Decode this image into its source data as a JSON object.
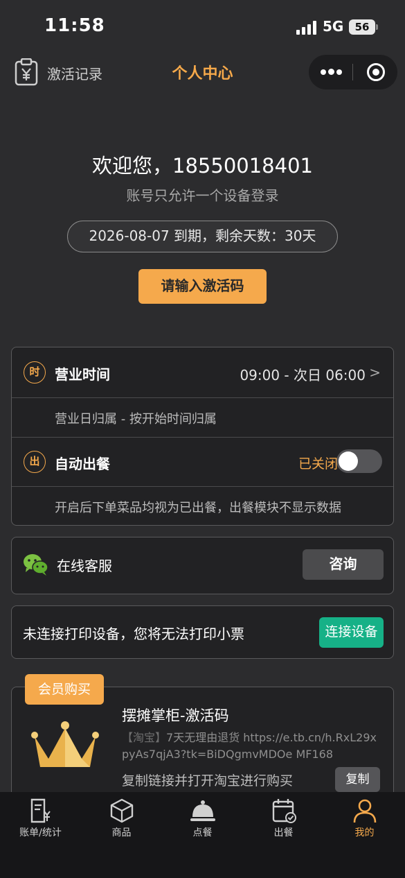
{
  "status_bar": {
    "time": "11:58",
    "network": "5G",
    "battery": "56"
  },
  "nav": {
    "left_label": "激活记录",
    "title": "个人中心"
  },
  "welcome": {
    "greeting": "欢迎您，18550018401",
    "note": "账号只允许一个设备登录",
    "expiry": "2026-08-07 到期，剩余天数：30天",
    "activate_button": "请输入激活码"
  },
  "settings": {
    "business_hours": {
      "badge": "时",
      "title": "营业时间",
      "value": "09:00 - 次日 06:00",
      "chevron": ">"
    },
    "business_day_rule": "营业日归属 - 按开始时间归属",
    "auto_serve": {
      "badge": "出",
      "title": "自动出餐",
      "state": "已关闭",
      "enabled": false
    },
    "auto_serve_desc": "开启后下单菜品均视为已出餐，出餐模块不显示数据"
  },
  "service": {
    "icon": "wechat-icon",
    "title": "在线客服",
    "button": "咨询"
  },
  "printer": {
    "message": "未连接打印设备，您将无法打印小票",
    "button": "连接设备"
  },
  "membership": {
    "tag": "会员购买",
    "product": "摆摊掌柜-激活码",
    "link_prefix": "【淘宝】",
    "link_body": "7天无理由退货 https://e.tb.cn/h.RxL29xpyAs7qjA3?tk=BiDQgmvMDOe MF168",
    "hint": "复制链接并打开淘宝进行购买",
    "copy_button": "复制"
  },
  "tabbar": [
    {
      "label": "账单/统计",
      "icon": "bill-icon"
    },
    {
      "label": "商品",
      "icon": "box-icon"
    },
    {
      "label": "点餐",
      "icon": "cloche-icon"
    },
    {
      "label": "出餐",
      "icon": "calendar-check-icon"
    },
    {
      "label": "我的",
      "icon": "user-icon",
      "active": true
    }
  ],
  "colors": {
    "accent": "#f5a94c",
    "connect": "#16b187",
    "background": "#2c2c2e"
  }
}
